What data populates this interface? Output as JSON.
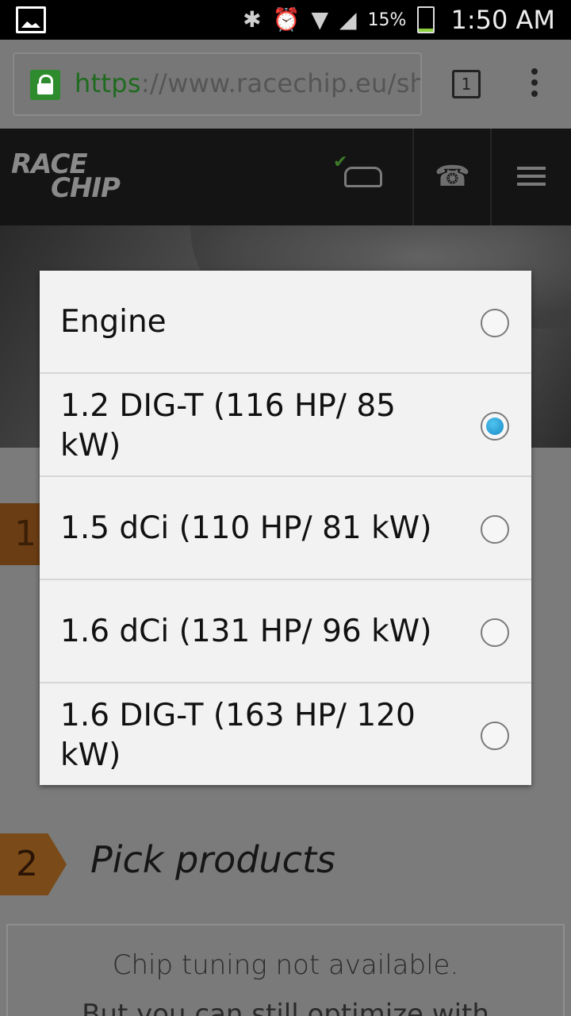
{
  "status_bar": {
    "battery_percent": "15%",
    "time": "1:50 AM"
  },
  "browser": {
    "url_protocol": "https",
    "url_separator": "://",
    "url_rest": "www.racechip.eu/sh",
    "tab_count": "1"
  },
  "site": {
    "logo_line1": "RACE",
    "logo_line2": "CHIP"
  },
  "engine_dialog": {
    "options": [
      {
        "label": "Engine",
        "selected": false
      },
      {
        "label": "1.2 DIG-T (116 HP/ 85 kW)",
        "selected": true
      },
      {
        "label": "1.5 dCi (110 HP/ 81 kW)",
        "selected": false
      },
      {
        "label": "1.6 dCi (131 HP/ 96 kW)",
        "selected": false
      },
      {
        "label": "1.6 DIG-T (163 HP/ 120 kW)",
        "selected": false
      }
    ]
  },
  "steps": {
    "step1_number": "1",
    "step2_number": "2",
    "step2_title": "Pick products"
  },
  "notice": {
    "line1": "Chip tuning not available.",
    "line2": "But you can still optimize with"
  },
  "colors": {
    "accent": "#1a8cc8",
    "step_badge": "#7a4a18",
    "ssl_green": "#2e8b2e"
  }
}
